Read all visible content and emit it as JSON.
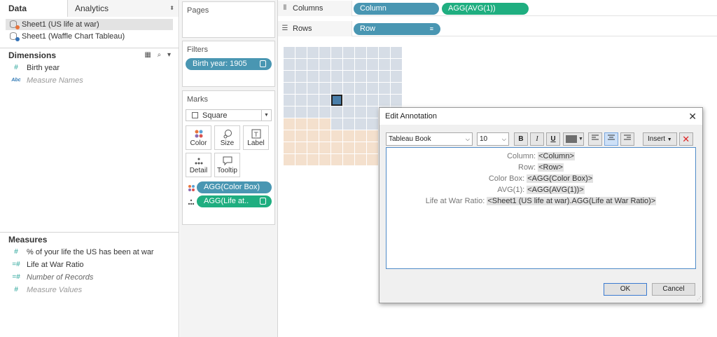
{
  "data_pane": {
    "tabs": [
      "Data",
      "Analytics"
    ],
    "tab_arrows": "⬍",
    "data_sources": [
      {
        "label": "Sheet1 (US life at war)",
        "dot": "#e8743b"
      },
      {
        "label": "Sheet1 (Waffle Chart Tableau)",
        "dot": "#3574b8"
      }
    ],
    "dimensions_title": "Dimensions",
    "dimensions": [
      {
        "icon": "#",
        "label": "Birth year"
      },
      {
        "icon": "Abc",
        "label": "Measure Names"
      }
    ],
    "measures_title": "Measures",
    "measures": [
      {
        "icon": "#",
        "label": "% of your life the US has been at war"
      },
      {
        "icon": "=#",
        "label": "Life at War Ratio"
      },
      {
        "icon": "=#",
        "label": "Number of Records"
      },
      {
        "icon": "#",
        "label": "Measure Values"
      }
    ]
  },
  "cards": {
    "pages_title": "Pages",
    "filters_title": "Filters",
    "filter_pill": "Birth year: 1905",
    "marks_title": "Marks",
    "mark_type": "Square",
    "mark_buttons": [
      "Color",
      "Size",
      "Label",
      "Detail",
      "Tooltip"
    ],
    "mark_pills": [
      {
        "label": "AGG(Color Box)",
        "color": "#4996b2"
      },
      {
        "label": "AGG(Life at..",
        "color": "#1fae80"
      }
    ]
  },
  "shelves": {
    "columns_label": "Columns",
    "rows_label": "Rows",
    "columns_pills": [
      "Column",
      "AGG(AVG(1))"
    ],
    "rows_pills": [
      "Row"
    ]
  },
  "viz": {
    "colors": {
      "filled": "#d6dde6",
      "empty": "#f4e0cd",
      "selected": "#4a7ea9"
    }
  },
  "dialog": {
    "title": "Edit Annotation",
    "close_glyph": "✕",
    "font": "Tableau Book",
    "size": "10",
    "bold": "B",
    "italic": "I",
    "underline": "U",
    "insert": "Insert",
    "lines": [
      {
        "label": "Column: ",
        "token": "<Column>"
      },
      {
        "label": "Row: ",
        "token": "<Row>"
      },
      {
        "label": "Color Box: ",
        "token": "<AGG(Color Box)>"
      },
      {
        "label": "AVG(1): ",
        "token": "<AGG(AVG(1))>"
      },
      {
        "label": "Life at War Ratio: ",
        "token": "<Sheet1 (US life at war).AGG(Life at War Ratio)>"
      }
    ],
    "ok": "OK",
    "cancel": "Cancel"
  }
}
